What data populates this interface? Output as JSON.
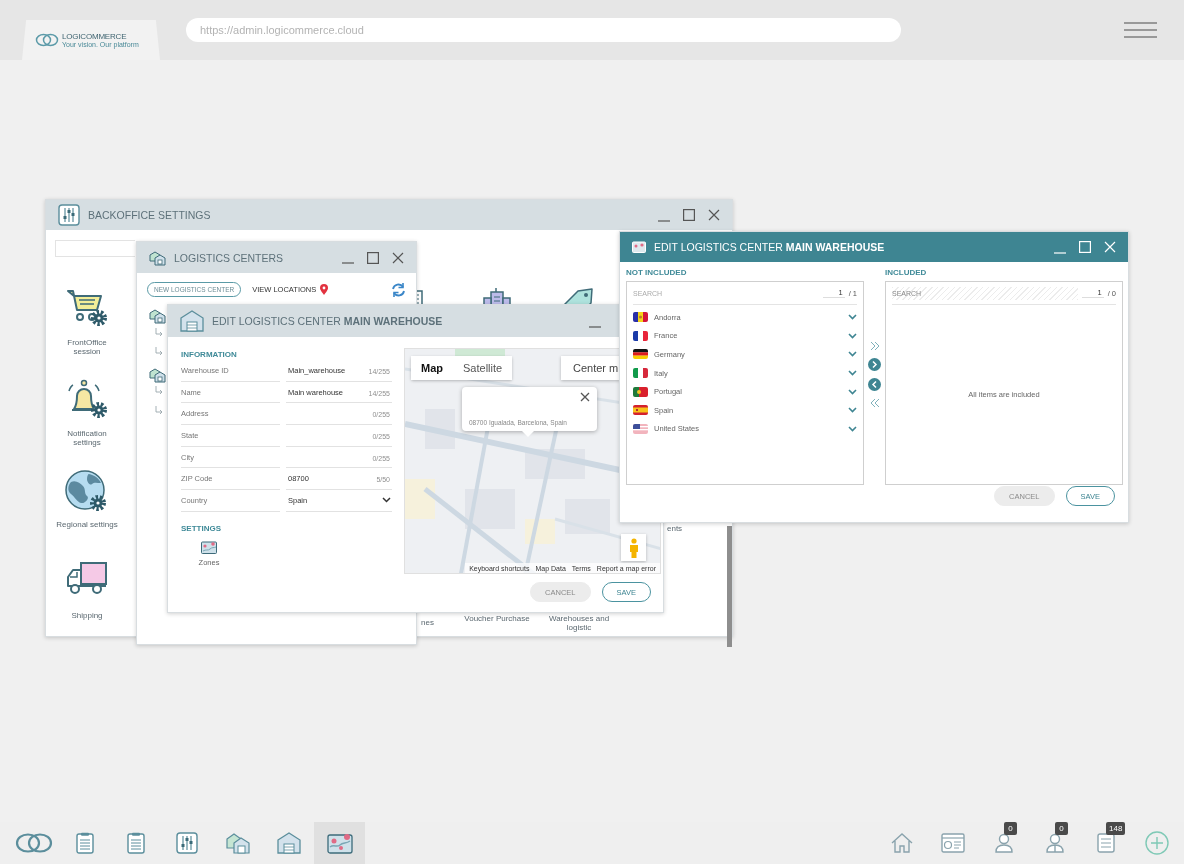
{
  "topbar": {
    "logo": "LOGICOMMERCE",
    "tagline": "Your vision. Our platform",
    "url": "https://admin.logicommerce.cloud"
  },
  "backoffice": {
    "title": "BACKOFFICE SETTINGS",
    "controls": [
      {
        "kind": "minimize"
      },
      {
        "kind": "maximize"
      },
      {
        "kind": "close"
      }
    ],
    "left_tiles": [
      {
        "kind": "cart",
        "label": "FrontOffice session"
      },
      {
        "kind": "bell",
        "label": "Notification settings"
      },
      {
        "kind": "globe",
        "label": "Regional settings"
      },
      {
        "kind": "truck",
        "label": "Shipping"
      }
    ],
    "top_icons": [
      {
        "kind": "stack"
      },
      {
        "kind": "building"
      },
      {
        "kind": "tag"
      }
    ],
    "side_labels": [
      {
        "kind": "tail",
        "label": "ents"
      }
    ],
    "bottom_labels": [
      {
        "kind": "tail",
        "label": "nes"
      },
      {
        "kind": "text",
        "label": "Voucher Purchase"
      },
      {
        "kind": "text",
        "label": "Warehouses and logistic"
      }
    ]
  },
  "logistics": {
    "title": "LOGISTICS CENTERS",
    "controls": [
      {
        "kind": "minimize"
      },
      {
        "kind": "maximize"
      },
      {
        "kind": "close"
      }
    ],
    "new_button": "NEW LOGISTICS CENTER",
    "view_locations": "VIEW LOCATIONS",
    "tree": [
      {
        "kind": "center",
        "children": [
          {
            "kind": "child"
          },
          {
            "kind": "child"
          }
        ]
      },
      {
        "kind": "center",
        "children": [
          {
            "kind": "child"
          },
          {
            "kind": "child"
          }
        ]
      }
    ]
  },
  "edit_center": {
    "title": "EDIT LOGISTICS CENTER **MAIN WAREHOUSE**",
    "controls": [
      {
        "kind": "minimize"
      }
    ],
    "information": {
      "title": "INFORMATION",
      "fields": [
        {
          "kind": "text",
          "label": "Warehouse ID",
          "value": "Main_warehouse",
          "counter": "14/255"
        },
        {
          "kind": "text",
          "label": "Name",
          "value": "Main warehouse",
          "counter": "14/255"
        },
        {
          "kind": "text",
          "label": "Address",
          "counter": "0/255"
        },
        {
          "kind": "text",
          "label": "State",
          "counter": "0/255"
        },
        {
          "kind": "text",
          "label": "City",
          "counter": "0/255"
        },
        {
          "kind": "text",
          "label": "ZIP Code",
          "value": "08700",
          "counter": "5/50"
        },
        {
          "kind": "select",
          "label": "Country",
          "value": "Spain"
        }
      ]
    },
    "settings": {
      "title": "SETTINGS",
      "items": [
        {
          "label": "Zones"
        }
      ]
    },
    "map": {
      "types": [
        {
          "label": "Map",
          "selected": true
        },
        {
          "label": "Satellite",
          "selected": false
        }
      ],
      "center_button": "Center m",
      "popup": "08700 Igualada, Barcelona, Spain",
      "footer": [
        "Keyboard shortcuts",
        "Map Data",
        "Terms",
        "Report a map error"
      ]
    },
    "buttons": [
      {
        "label": "CANCEL",
        "disabled": true
      },
      {
        "label": "SAVE",
        "disabled": false
      }
    ]
  },
  "edit_zones": {
    "title": "EDIT LOGISTICS CENTER **MAIN WAREHOUSE**",
    "controls": [
      {
        "kind": "minimize"
      },
      {
        "kind": "maximize"
      },
      {
        "kind": "close"
      }
    ],
    "not_included": {
      "title": "NOT INCLUDED",
      "search": {
        "placeholder": "SEARCH",
        "disabled": false
      },
      "page": "1",
      "total": "/ 1",
      "items": [
        {
          "kind": "ad",
          "name": "Andorra"
        },
        {
          "kind": "fr",
          "name": "France"
        },
        {
          "kind": "de",
          "name": "Germany"
        },
        {
          "kind": "it",
          "name": "Italy"
        },
        {
          "kind": "pt",
          "name": "Portugal"
        },
        {
          "kind": "es",
          "name": "Spain"
        },
        {
          "kind": "us",
          "name": "United States"
        }
      ]
    },
    "included": {
      "title": "INCLUDED",
      "search": {
        "placeholder": "SEARCH",
        "disabled": true
      },
      "page": "1",
      "total": "/ 0",
      "empty_message": "All items are included"
    },
    "buttons": [
      {
        "label": "CANCEL",
        "disabled": true
      },
      {
        "label": "SAVE",
        "disabled": false
      }
    ]
  },
  "taskbar": {
    "apps": [
      {
        "kind": "logo",
        "selected": false
      },
      {
        "kind": "clipboard",
        "selected": false
      },
      {
        "kind": "clipboard",
        "selected": false
      },
      {
        "kind": "sliders",
        "selected": false
      },
      {
        "kind": "warehouses",
        "selected": false
      },
      {
        "kind": "warehouse",
        "selected": false
      },
      {
        "kind": "map",
        "selected": true
      }
    ],
    "tray": [
      {
        "kind": "home"
      },
      {
        "kind": "dashboard"
      },
      {
        "kind": "user",
        "badge": "0"
      },
      {
        "kind": "users",
        "badge": "0"
      },
      {
        "kind": "list",
        "badge": "148"
      },
      {
        "kind": "add"
      }
    ]
  }
}
